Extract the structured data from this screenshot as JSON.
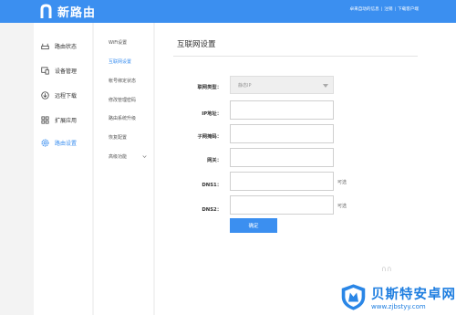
{
  "header": {
    "brand": "新路由",
    "links": [
      "卓来自动的信息",
      "注销",
      "下载客户端"
    ],
    "separator": "|"
  },
  "sidebar": {
    "items": [
      {
        "label": "路由状态",
        "icon": "router-icon"
      },
      {
        "label": "设备管理",
        "icon": "devices-icon"
      },
      {
        "label": "远程下载",
        "icon": "download-icon"
      },
      {
        "label": "扩展应用",
        "icon": "apps-icon"
      },
      {
        "label": "路由设置",
        "icon": "settings-icon",
        "active": true
      }
    ]
  },
  "subnav": {
    "items": [
      {
        "label": "WiFi设置"
      },
      {
        "label": "互联网设置",
        "active": true
      },
      {
        "label": "帐号绑定状态"
      },
      {
        "label": "修改管理密码"
      },
      {
        "label": "路由系统升级"
      },
      {
        "label": "恢复配置"
      },
      {
        "label": "高级功能"
      }
    ]
  },
  "main": {
    "title": "互联网设置",
    "form": {
      "connection_type": {
        "label": "联网类型：",
        "value": "静态IP"
      },
      "ip": {
        "label": "IP地址：",
        "value": ""
      },
      "subnet": {
        "label": "子网掩码：",
        "value": ""
      },
      "gateway": {
        "label": "网关：",
        "value": ""
      },
      "dns1": {
        "label": "DNS1：",
        "value": "",
        "hint": "可选"
      },
      "dns2": {
        "label": "DNS2：",
        "value": "",
        "hint": "可选"
      }
    },
    "confirm_label": "确定",
    "loading_mark": "∩∩"
  },
  "watermark": {
    "title": "贝斯特安卓网",
    "url": "www.zjbstyy.com"
  },
  "colors": {
    "accent": "#3b8ff0",
    "header_bg": "#3b8ff0",
    "watermark_blue": "#1e7ee0"
  }
}
